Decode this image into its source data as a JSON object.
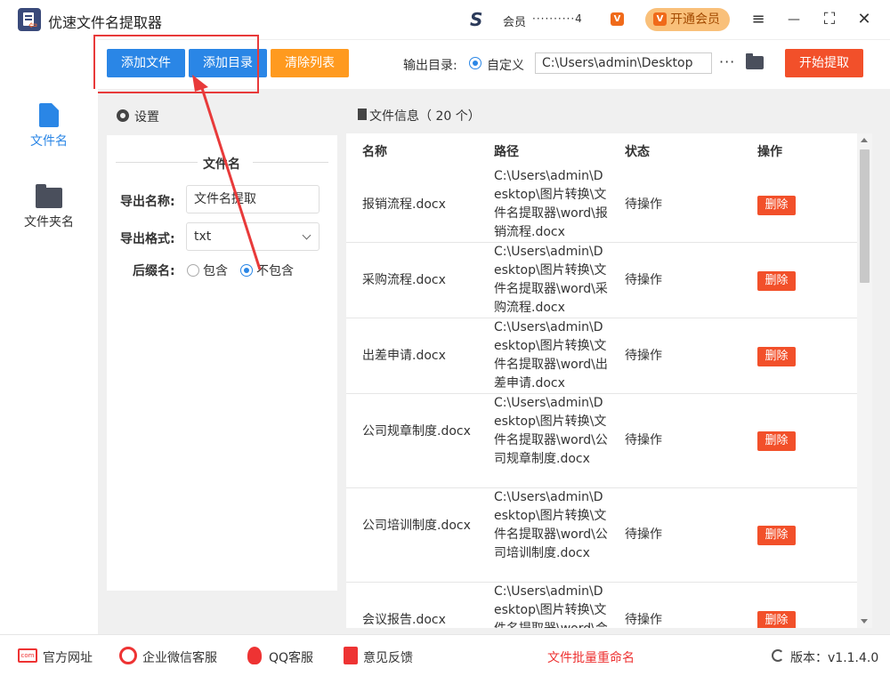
{
  "app": {
    "title": "优速文件名提取器"
  },
  "member": {
    "label": "会员",
    "id": "4",
    "vip_button": "开通会员",
    "vip_badge": "V"
  },
  "window": {
    "menu": "≡",
    "minimize": "—",
    "maximize": "⛶",
    "close": "✕"
  },
  "toolbar": {
    "add_file": "添加文件",
    "add_dir": "添加目录",
    "clear_list": "清除列表",
    "output_label": "输出目录:",
    "output_option": "自定义",
    "output_path": "C:\\Users\\admin\\Desktop",
    "more": "···",
    "start": "开始提取"
  },
  "sidebar": {
    "items": [
      {
        "label": "文件名"
      },
      {
        "label": "文件夹名"
      }
    ]
  },
  "settings": {
    "title": "设置",
    "section": "文件名",
    "export_name_label": "导出名称:",
    "export_name_value": "文件名提取",
    "export_format_label": "导出格式:",
    "export_format_value": "txt",
    "suffix_label": "后缀名:",
    "suffix_include": "包含",
    "suffix_exclude": "不包含",
    "suffix_selected": "不包含"
  },
  "filelist": {
    "title": "文件信息（ 20 个）",
    "columns": {
      "name": "名称",
      "path": "路径",
      "status": "状态",
      "action": "操作"
    },
    "rows": [
      {
        "name": "报销流程.docx",
        "path": "C:\\Users\\admin\\Desktop\\图片转换\\文件名提取器\\word\\报销流程.docx",
        "status": "待操作",
        "action": "删除"
      },
      {
        "name": "采购流程.docx",
        "path": "C:\\Users\\admin\\Desktop\\图片转换\\文件名提取器\\word\\采购流程.docx",
        "status": "待操作",
        "action": "删除"
      },
      {
        "name": "出差申请.docx",
        "path": "C:\\Users\\admin\\Desktop\\图片转换\\文件名提取器\\word\\出差申请.docx",
        "status": "待操作",
        "action": "删除"
      },
      {
        "name": "公司规章制度.docx",
        "path": "C:\\Users\\admin\\Desktop\\图片转换\\文件名提取器\\word\\公司规章制度.docx",
        "status": "待操作",
        "action": "删除"
      },
      {
        "name": "公司培训制度.docx",
        "path": "C:\\Users\\admin\\Desktop\\图片转换\\文件名提取器\\word\\公司培训制度.docx",
        "status": "待操作",
        "action": "删除"
      },
      {
        "name": "会议报告.docx",
        "path": "C:\\Users\\admin\\Desktop\\图片转换\\文件名提取器\\word\\会议报告.docx",
        "status": "待操作",
        "action": "删除"
      }
    ]
  },
  "footer": {
    "website": "官方网址",
    "wechat": "企业微信客服",
    "qq": "QQ客服",
    "feedback": "意见反馈",
    "batch_rename": "文件批量重命名",
    "version": "版本：v1.1.4.0",
    "web_icon_text": "com"
  },
  "colors": {
    "primary": "#2a86e6",
    "orange": "#ff9a1f",
    "red": "#f2502a",
    "annotation": "#e83a3a"
  }
}
